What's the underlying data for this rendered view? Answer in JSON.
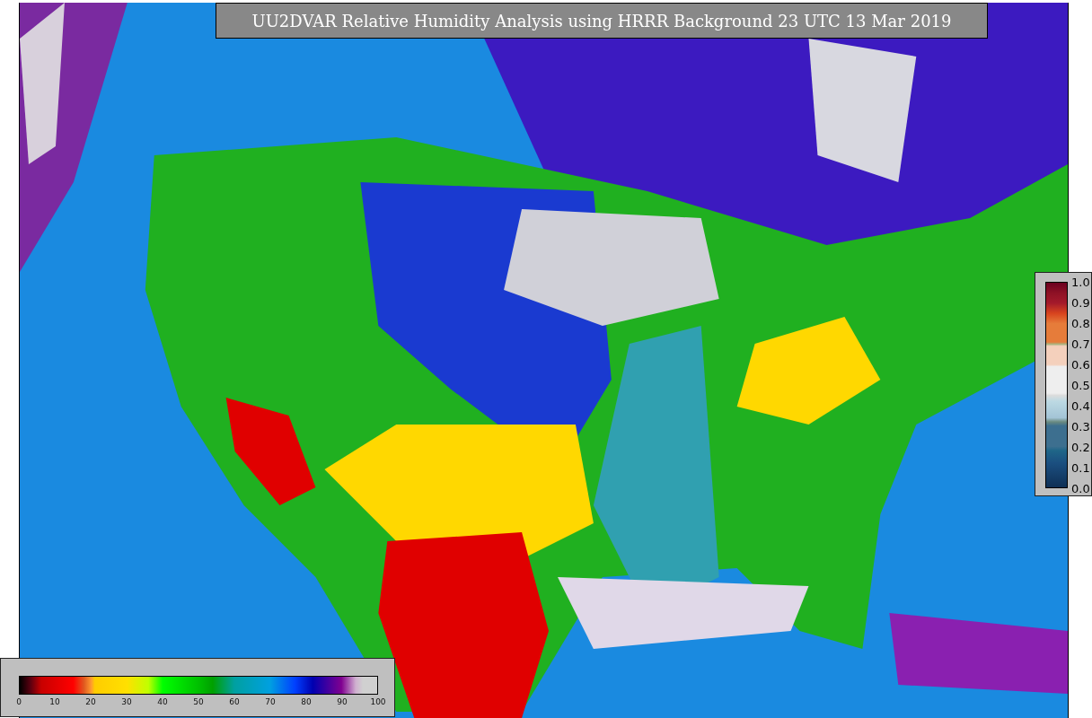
{
  "title": "UU2DVAR Relative Humidity Analysis using HRRR Background 23 UTC 13 Mar 2019",
  "fraction_legend": {
    "ticks": [
      "1.0",
      "0.9",
      "0.8",
      "0.7",
      "0.6",
      "0.5",
      "0.4",
      "0.3",
      "0.2",
      "0.1",
      "0.0"
    ]
  },
  "humidity_legend": {
    "ticks": [
      "0",
      "10",
      "20",
      "30",
      "40",
      "50",
      "60",
      "70",
      "80",
      "90",
      "100"
    ]
  }
}
